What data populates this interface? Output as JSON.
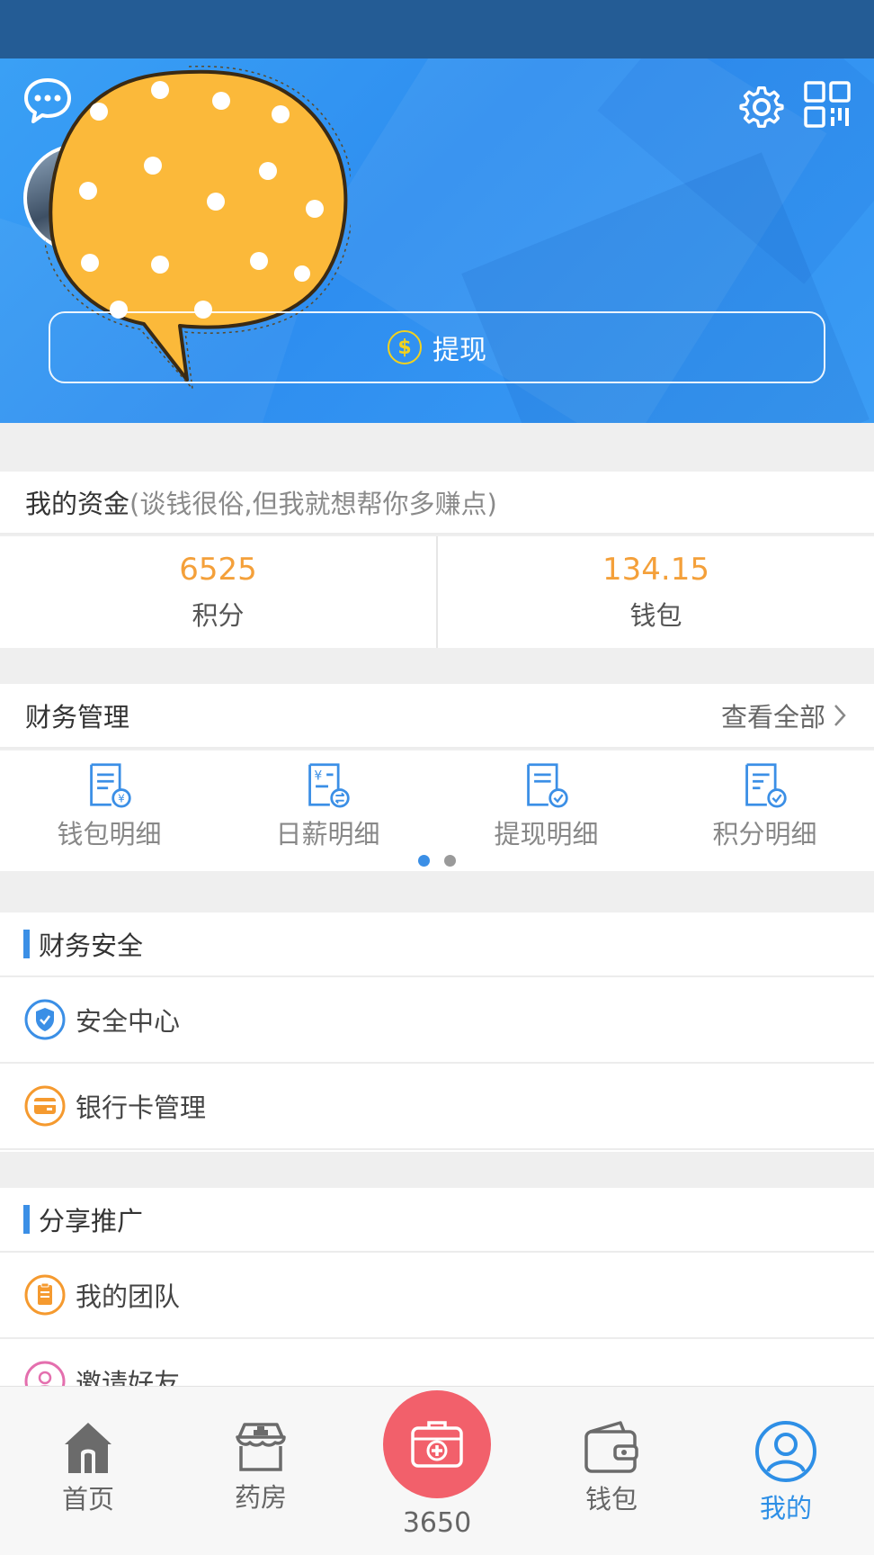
{
  "header": {
    "withdraw_label": "提现"
  },
  "funds": {
    "title": "我的资金",
    "subtitle": "(谈钱很俗,但我就想帮你多赚点)",
    "points_value": "6525",
    "points_label": "积分",
    "wallet_value": "134.15",
    "wallet_label": "钱包"
  },
  "finance": {
    "title": "财务管理",
    "view_all": "查看全部",
    "items": [
      {
        "label": "钱包明细",
        "icon": "wallet-detail-icon"
      },
      {
        "label": "日薪明细",
        "icon": "daily-salary-detail-icon"
      },
      {
        "label": "提现明细",
        "icon": "withdraw-detail-icon"
      },
      {
        "label": "积分明细",
        "icon": "points-detail-icon"
      }
    ],
    "page_count": 2,
    "active_page": 1
  },
  "security": {
    "title": "财务安全",
    "items": [
      {
        "label": "安全中心",
        "icon": "shield-icon",
        "color": "#3b8fe6"
      },
      {
        "label": "银行卡管理",
        "icon": "bank-card-icon",
        "color": "#f59a2f"
      }
    ]
  },
  "share": {
    "title": "分享推广",
    "items": [
      {
        "label": "我的团队",
        "icon": "team-icon",
        "color": "#f59a2f"
      },
      {
        "label": "邀请好友",
        "icon": "invite-icon",
        "color": "#e46fae"
      }
    ]
  },
  "tabbar": {
    "home": "首页",
    "pharmacy": "药房",
    "center": "3650",
    "wallet": "钱包",
    "me": "我的",
    "active": "me",
    "active_color": "#2e8fe6",
    "center_color": "#f2606b"
  },
  "colors": {
    "statusbar": "#245c95",
    "accent": "#3b8fe6",
    "amount": "#f4a03a"
  }
}
